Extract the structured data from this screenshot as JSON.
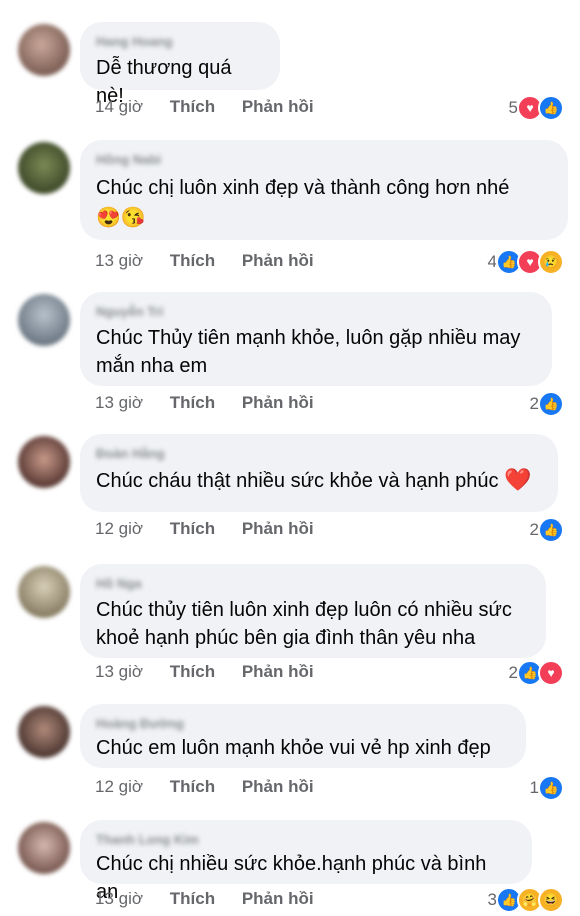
{
  "colors": {
    "bubble": "#f0f2f5",
    "like": "#1877f2",
    "love": "#f33e58",
    "yellow": "#f7b125",
    "meta": "#65676b"
  },
  "actions": {
    "like": "Thích",
    "reply": "Phản hồi"
  },
  "comments": [
    {
      "author": "Hang Hoang",
      "text": "Dễ thương quá nè!",
      "time": "14 giờ",
      "count": "5",
      "reactions": [
        "like",
        "love"
      ]
    },
    {
      "author": "Hồng Nabi",
      "text": "Chúc chị luôn xinh đẹp và thành công hơn nhé",
      "emojis": "😍😘",
      "time": "13 giờ",
      "count": "4",
      "reactions": [
        "like",
        "love",
        "sad"
      ]
    },
    {
      "author": "Nguyễn Trí",
      "text": "Chúc Thủy tiên mạnh khỏe, luôn gặp nhiều may mắn nha em",
      "time": "13 giờ",
      "count": "2",
      "reactions": [
        "like"
      ]
    },
    {
      "author": "Đoàn Hằng",
      "text": "Chúc cháu thật nhiều sức khỏe và hạnh phúc",
      "heart": "❤️",
      "time": "12 giờ",
      "count": "2",
      "reactions": [
        "like"
      ]
    },
    {
      "author": "Hồ Nga",
      "text": "Chúc thủy tiên luôn xinh đẹp luôn có nhiều sức khoẻ hạnh phúc bên gia đình thân yêu nha",
      "time": "13 giờ",
      "count": "2",
      "reactions": [
        "like",
        "love"
      ]
    },
    {
      "author": "Hoàng Đường",
      "text": "Chúc em luôn mạnh khỏe vui vẻ  hp xinh đẹp",
      "time": "12 giờ",
      "count": "1",
      "reactions": [
        "like"
      ]
    },
    {
      "author": "Thanh Long Kim",
      "text": "Chúc chị nhiều sức khỏe.hạnh phúc và bình an",
      "time": "13 giờ",
      "count": "3",
      "reactions": [
        "like",
        "care",
        "haha"
      ]
    }
  ]
}
